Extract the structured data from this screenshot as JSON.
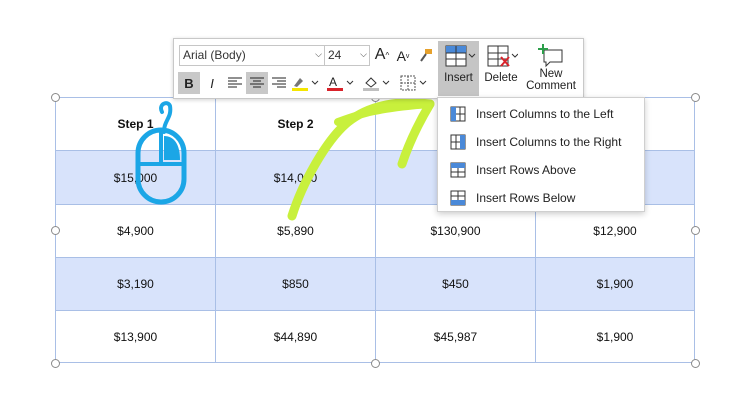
{
  "table": {
    "headers": [
      "Step 1",
      "Step 2",
      "",
      ""
    ],
    "rows": [
      [
        "$15,000",
        "$14,090",
        "$",
        ""
      ],
      [
        "$4,900",
        "$5,890",
        "$130,900",
        "$12,900"
      ],
      [
        "$3,190",
        "$850",
        "$450",
        "$1,900"
      ],
      [
        "$13,900",
        "$44,890",
        "$45,987",
        "$1,900"
      ]
    ]
  },
  "toolbar": {
    "font_name": "Arial (Body)",
    "font_size": "24",
    "bold": "B",
    "italic": "I",
    "insert_label": "Insert",
    "delete_label": "Delete",
    "new_comment_line1": "New",
    "new_comment_line2": "Comment"
  },
  "insert_menu": {
    "items": [
      "Insert Columns to the Left",
      "Insert Columns to the Right",
      "Insert Rows Above",
      "Insert Rows Below"
    ]
  },
  "colors": {
    "band": "#d8e3fb",
    "grid": "#a9bfe6",
    "highlight": "#c8f03c",
    "mouse": "#1ba6e6"
  }
}
